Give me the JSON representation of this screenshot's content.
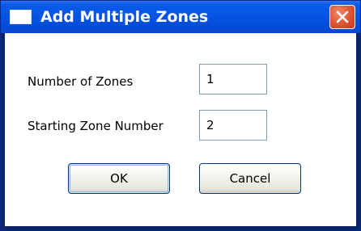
{
  "window": {
    "title": "Add Multiple Zones",
    "icon": "window-icon",
    "close_icon": "close-icon"
  },
  "form": {
    "number_of_zones": {
      "label": "Number of Zones",
      "value": "1"
    },
    "starting_zone_number": {
      "label": "Starting Zone Number",
      "value": "2"
    }
  },
  "buttons": {
    "ok": "OK",
    "cancel": "Cancel"
  },
  "colors": {
    "titlebar": "#0553e3",
    "close_button": "#e05a35",
    "input_border": "#7f9db9",
    "button_border": "#003c74"
  }
}
